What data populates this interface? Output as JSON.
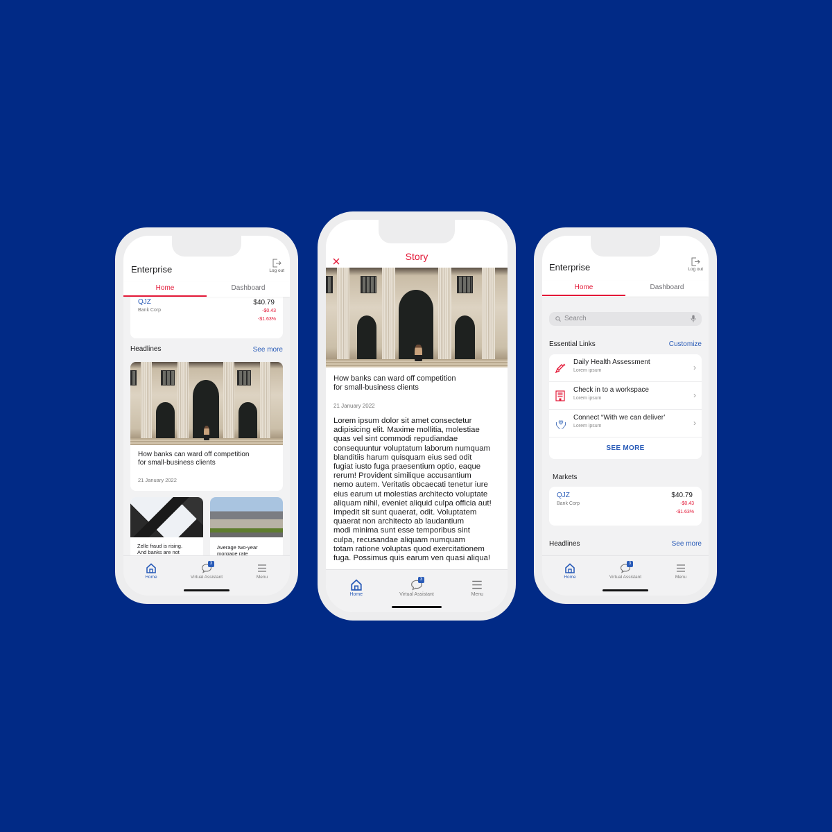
{
  "background_color": "#012a86",
  "accent_red": "#e31837",
  "accent_blue": "#2a5cb8",
  "phone_left": {
    "app_title": "Enterprise",
    "logout_label": "Log out",
    "tabs": [
      {
        "label": "Home",
        "active": true
      },
      {
        "label": "Dashboard",
        "active": false
      }
    ],
    "market": {
      "ticker": "QJZ",
      "company": "Bank Corp",
      "price": "$40.79",
      "change": "-$0.43",
      "change_pct": "-$1.63%"
    },
    "headlines_title": "Headlines",
    "see_more": "See more",
    "featured": {
      "title_line1": "How banks can ward off competition",
      "title_line2": "for small-business clients",
      "date": "21 January 2022"
    },
    "small_cards": [
      {
        "line1": "Zelle fraud is rising.",
        "line2": "And banks are not"
      },
      {
        "line1": "Average two-year",
        "line2": "morgage rate"
      }
    ],
    "nav": [
      {
        "label": "Home",
        "icon": "home-icon",
        "active": true
      },
      {
        "label": "Virtual Assistant",
        "icon": "chat-icon",
        "badge": "3"
      },
      {
        "label": "Menu",
        "icon": "menu-icon"
      }
    ]
  },
  "phone_center": {
    "header_title": "Story",
    "close_icon": "close-icon",
    "article_title_line1": "How banks can ward off competition",
    "article_title_line2": "for small-business clients",
    "date": "21 January 2022",
    "body_lines": [
      "Lorem ipsum dolor sit amet consectetur",
      "adipisicing elit. Maxime mollitia, molestiae",
      "quas vel sint commodi repudiandae",
      "consequuntur voluptatum laborum numquam",
      "blanditiis harum quisquam eius sed odit",
      "fugiat iusto fuga praesentium optio, eaque",
      "rerum! Provident similique accusantium",
      "nemo autem. Veritatis obcaecati tenetur iure",
      "eius earum ut molestias architecto voluptate",
      "aliquam nihil, eveniet aliquid culpa officia aut!",
      "Impedit sit sunt quaerat, odit. Voluptatem",
      "quaerat non architecto ab laudantium",
      "modi minima sunt esse temporibus sint",
      "culpa, recusandae aliquam numquam",
      "totam ratione voluptas quod exercitationem",
      "fuga. Possimus quis earum ven quasi aliqua!"
    ],
    "nav": [
      {
        "label": "Home",
        "icon": "home-icon",
        "active": true
      },
      {
        "label": "Virtual Assistant",
        "icon": "chat-icon",
        "badge": "3"
      },
      {
        "label": "Menu",
        "icon": "menu-icon"
      }
    ]
  },
  "phone_right": {
    "app_title": "Enterprise",
    "logout_label": "Log out",
    "tabs": [
      {
        "label": "Home",
        "active": true
      },
      {
        "label": "Dashboard",
        "active": false
      }
    ],
    "search_placeholder": "Search",
    "essential_title": "Essential Links",
    "customize": "Customize",
    "links": [
      {
        "title": "Daily Health Assessment",
        "subtitle": "Lorem ipsum",
        "icon": "syringe-icon"
      },
      {
        "title": "Check in to a workspace",
        "subtitle": "Lorem ipsum",
        "icon": "building-icon"
      },
      {
        "title": "Connect “With we can deliver’",
        "subtitle": "Lorem ipsum",
        "icon": "hands-heart-icon"
      }
    ],
    "see_more_button": "SEE MORE",
    "markets_title": "Markets",
    "market": {
      "ticker": "QJZ",
      "company": "Bank Corp",
      "price": "$40.79",
      "change": "-$0.43",
      "change_pct": "-$1.63%"
    },
    "headlines_title": "Headlines",
    "see_more": "See more",
    "nav": [
      {
        "label": "Home",
        "icon": "home-icon",
        "active": true
      },
      {
        "label": "Virtual Assistant",
        "icon": "chat-icon",
        "badge": "3"
      },
      {
        "label": "Menu",
        "icon": "menu-icon"
      }
    ]
  }
}
